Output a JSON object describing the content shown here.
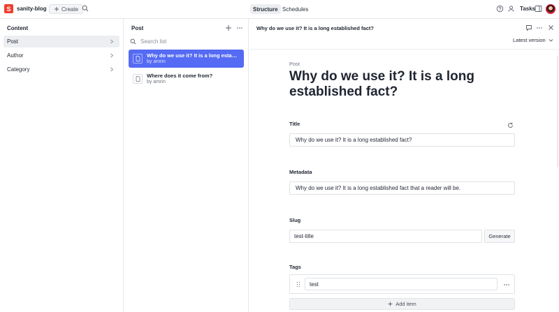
{
  "navbar": {
    "logo_letter": "S",
    "project_name": "sanity-blog",
    "create_label": "Create",
    "tabs": [
      {
        "label": "Structure",
        "active": true
      },
      {
        "label": "Schedules",
        "active": false
      }
    ],
    "tasks_label": "Tasks"
  },
  "content_pane": {
    "title": "Content",
    "items": [
      {
        "label": "Post",
        "active": true
      },
      {
        "label": "Author",
        "active": false
      },
      {
        "label": "Category",
        "active": false
      }
    ]
  },
  "list_pane": {
    "title": "Post",
    "search_placeholder": "Search list",
    "documents": [
      {
        "title": "Why do we use it? It is a long established fact?",
        "subtitle": "by amrin",
        "active": true
      },
      {
        "title": "Where does it come from?",
        "subtitle": "by amrin",
        "active": false
      }
    ]
  },
  "editor": {
    "header_title": "Why do we use it? It is a long established fact?",
    "version_label": "Latest version",
    "doc_type": "Post",
    "heading": "Why do we use it? It is a long established fact?",
    "fields": {
      "title": {
        "label": "Title",
        "value": "Why do we use it?  It is a long established fact?"
      },
      "metadata": {
        "label": "Metadata",
        "value": "Why do we use it?  It is a long established fact that a reader will be."
      },
      "slug": {
        "label": "Slug",
        "value": "test-title",
        "button": "Generate"
      },
      "tags": {
        "label": "Tags",
        "items": [
          "test"
        ],
        "add_label": "Add item"
      }
    }
  },
  "colors": {
    "accent": "#556bf3",
    "logo": "#f03e2f"
  }
}
